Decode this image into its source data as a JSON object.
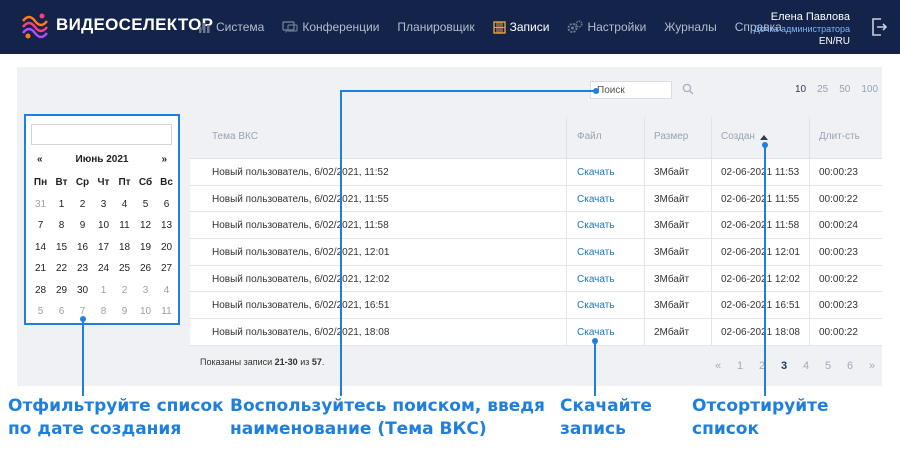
{
  "app": {
    "brand": "ВИДЕОСЕЛЕКТОР",
    "nav": [
      {
        "label": "Система",
        "icon": "bar-chart-icon"
      },
      {
        "label": "Конференции",
        "icon": "chat-icon"
      },
      {
        "label": "Планировщик",
        "icon": ""
      },
      {
        "label": "Записи",
        "icon": "film-icon",
        "active": true
      },
      {
        "label": "Настройки",
        "icon": "gears-icon"
      },
      {
        "label": "Журналы",
        "icon": ""
      },
      {
        "label": "Справка",
        "icon": ""
      }
    ],
    "user": {
      "name": "Елена Павлова",
      "role": "Дочка администратора",
      "lang": "EN/RU"
    }
  },
  "colors": {
    "nav_bg": "#13234a",
    "accent": "#1f7fdc",
    "panel_bg": "#eff1f5",
    "link": "#1e73c8"
  },
  "search": {
    "placeholder": "Поиск",
    "value": "Поиск"
  },
  "page_sizes": [
    "10",
    "25",
    "50",
    "100"
  ],
  "calendar": {
    "input_value": "",
    "prev": "«",
    "next": "»",
    "month": "Июнь 2021",
    "weekdays": [
      "Пн",
      "Вт",
      "Ср",
      "Чт",
      "Пт",
      "Сб",
      "Вс"
    ],
    "weeks": [
      [
        "31",
        "1",
        "2",
        "3",
        "4",
        "5",
        "6"
      ],
      [
        "7",
        "8",
        "9",
        "10",
        "11",
        "12",
        "13"
      ],
      [
        "14",
        "15",
        "16",
        "17",
        "18",
        "19",
        "20"
      ],
      [
        "21",
        "22",
        "23",
        "24",
        "25",
        "26",
        "27"
      ],
      [
        "28",
        "29",
        "30",
        "1",
        "2",
        "3",
        "4"
      ],
      [
        "5",
        "6",
        "7",
        "8",
        "9",
        "10",
        "11"
      ]
    ]
  },
  "table": {
    "headers": [
      "Тема ВКС",
      "Файл",
      "Размер",
      "Создан",
      "Длит-сть"
    ],
    "sorted_column": "Создан",
    "rows": [
      [
        "Новый пользователь, 6/02/2021, 11:52",
        "Скачать",
        "3Мбайт",
        "02-06-2021 11:53",
        "00:00:23"
      ],
      [
        "Новый пользователь, 6/02/2021, 11:55",
        "Скачать",
        "3Мбайт",
        "02-06-2021 11:55",
        "00:00:22"
      ],
      [
        "Новый пользователь, 6/02/2021, 11:58",
        "Скачать",
        "3Мбайт",
        "02-06-2021 11:58",
        "00:00:24"
      ],
      [
        "Новый пользователь, 6/02/2021, 12:01",
        "Скачать",
        "3Мбайт",
        "02-06-2021 12:01",
        "00:00:23"
      ],
      [
        "Новый пользователь, 6/02/2021, 12:02",
        "Скачать",
        "3Мбайт",
        "02-06-2021 12:02",
        "00:00:22"
      ],
      [
        "Новый пользователь, 6/02/2021, 16:51",
        "Скачать",
        "3Мбайт",
        "02-06-2021 16:51",
        "00:00:23"
      ],
      [
        "Новый пользователь, 6/02/2021, 18:08",
        "Скачать",
        "2Мбайт",
        "02-06-2021 18:08",
        "00:00:22"
      ]
    ],
    "info": {
      "prefix": "Показаны записи ",
      "range": "21-30",
      "middle": " из ",
      "total": "57",
      "suffix": "."
    }
  },
  "pagination": {
    "first": "«",
    "pages": [
      "1",
      "2",
      "3",
      "4",
      "5",
      "6"
    ],
    "current": "3",
    "last": "»"
  },
  "annotations": {
    "filter": [
      "Отфильтруйте список",
      "по дате создания"
    ],
    "search": [
      "Воспользуйтесь поиском, введя",
      "наименование (Тема ВКС)"
    ],
    "download": [
      "Скачайте",
      "запись"
    ],
    "sort": [
      "Отсортируйте",
      "список"
    ]
  }
}
